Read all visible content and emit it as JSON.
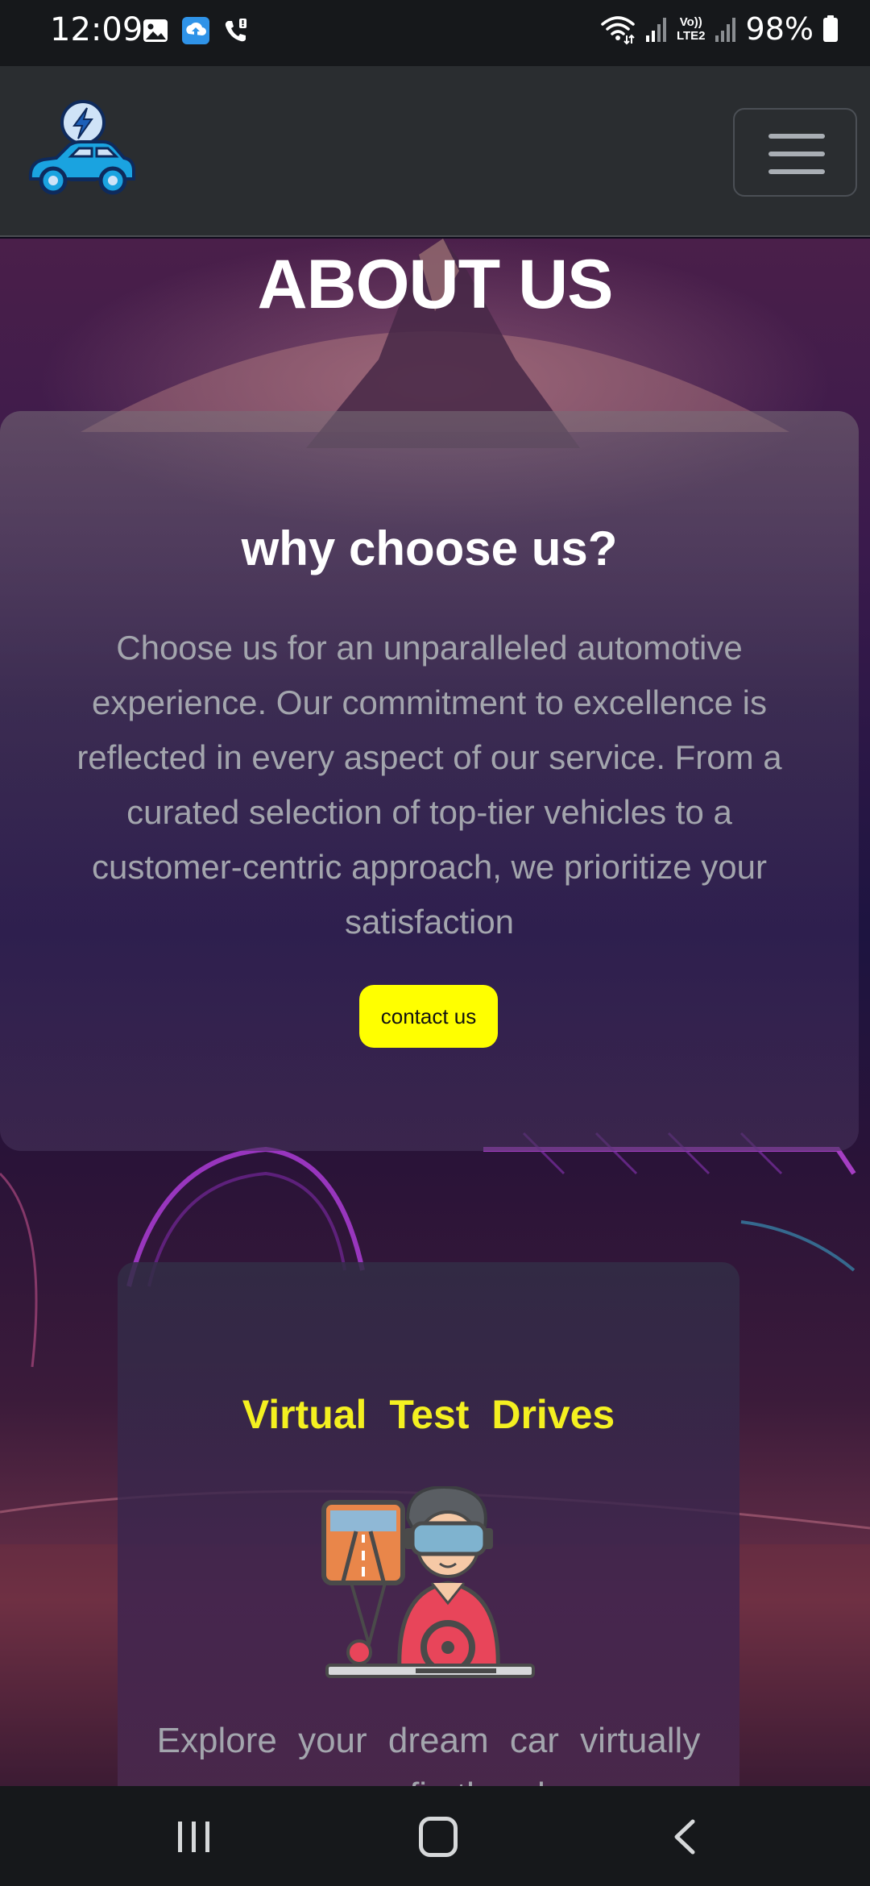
{
  "status_bar": {
    "time": "12:09",
    "battery": "98%",
    "icons": [
      "gallery-icon",
      "cloud-upload-icon",
      "wifi-call-icon",
      "wifi-icon",
      "signal-icon",
      "volte-icon",
      "battery-icon"
    ],
    "volte_label_top": "Vo))",
    "volte_label_bottom": "LTE2"
  },
  "navbar": {
    "logo": "ev-car-logo",
    "menu_icon": "hamburger-icon"
  },
  "hero": {
    "title": "ABOUT US"
  },
  "why_card": {
    "title": "why choose us?",
    "text": "Choose us for an unparalleled automotive experience. Our commitment to excellence is reflected in every aspect of our service. From a curated selection of top-tier vehicles to a customer-centric approach, we prioritize your satisfaction",
    "button_label": "contact us"
  },
  "feature_card": {
    "title": "Virtual  Test  Drives",
    "text": "Explore your dream car virtually — a firsthand"
  },
  "bottom_nav": {
    "items": [
      "recent-apps-icon",
      "home-icon",
      "back-icon"
    ]
  },
  "colors": {
    "accent_yellow": "#ffff00",
    "navbar_bg": "#2a2d30",
    "status_bar_bg": "#16181b"
  }
}
